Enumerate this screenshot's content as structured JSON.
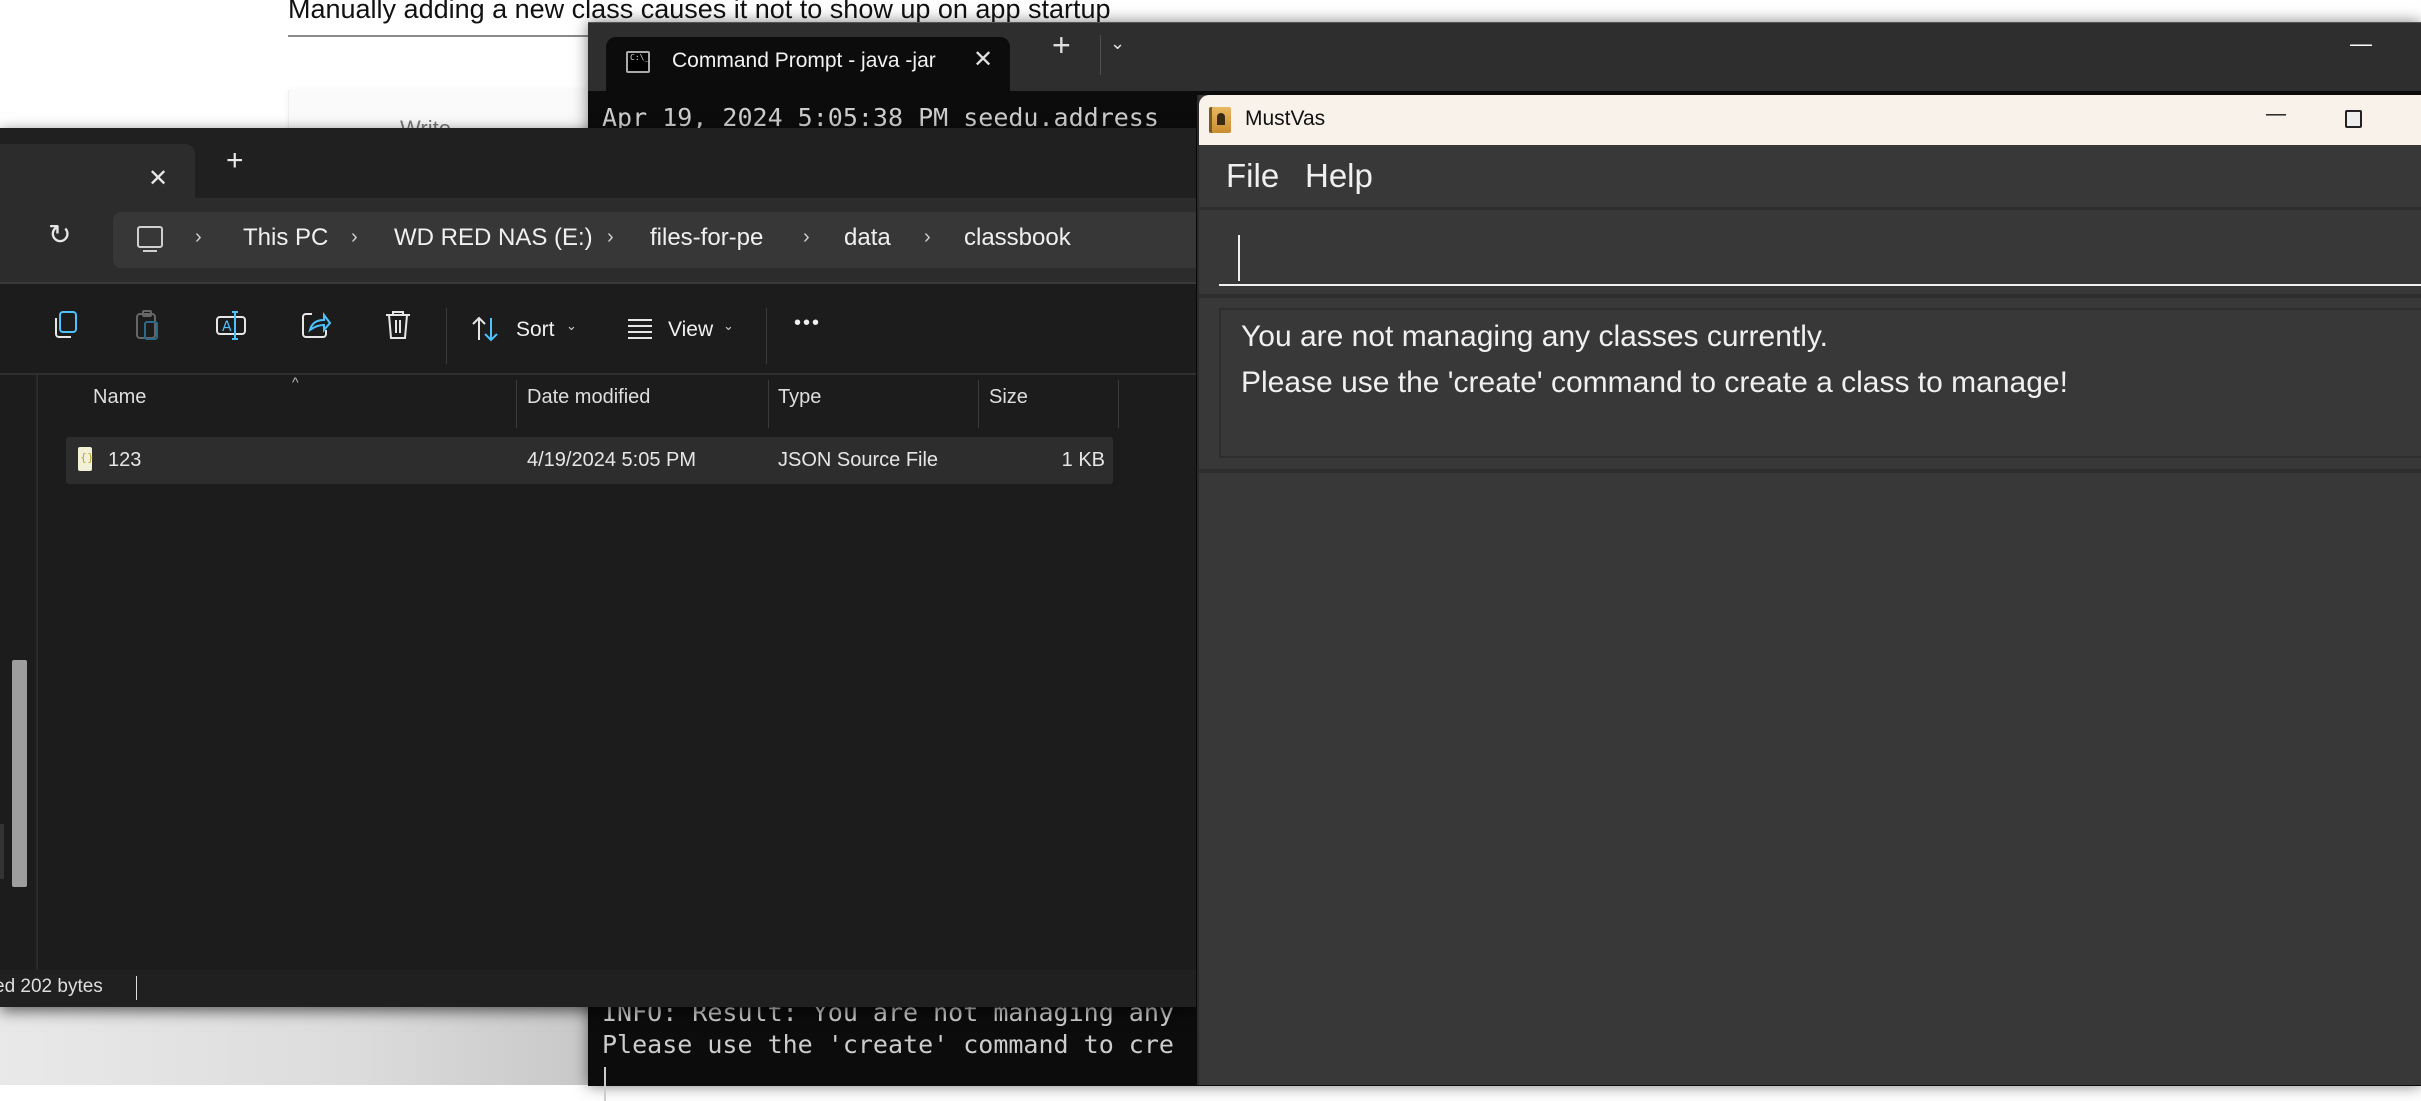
{
  "background_page": {
    "heading": "Manually adding a new class causes it not to show up on app startup",
    "write_tab": "Write"
  },
  "terminal": {
    "tab_title": "Command Prompt - java  -jar",
    "icon": "cmd-icon",
    "lines": [
      "Apr 19, 2024 5:05:38 PM seedu.address",
      "INFO: Result: You are not managing any",
      "Please use the 'create' command to cre"
    ]
  },
  "explorer": {
    "breadcrumb": [
      "This PC",
      "WD RED NAS (E:)",
      "files-for-pe",
      "data",
      "classbook"
    ],
    "toolbar": {
      "icons": [
        "copy-icon",
        "paste-icon",
        "rename-icon",
        "share-icon",
        "delete-icon"
      ],
      "sort_label": "Sort",
      "view_label": "View",
      "more_label": "•••"
    },
    "columns": [
      "Name",
      "Date modified",
      "Type",
      "Size"
    ],
    "files": [
      {
        "name": "123",
        "date_modified": "4/19/2024 5:05 PM",
        "type": "JSON Source File",
        "size": "1 KB"
      }
    ],
    "status": "ed  202 bytes"
  },
  "mustvas": {
    "title": "MustVas",
    "menu": [
      "File",
      "Help"
    ],
    "command_input": {
      "value": "",
      "placeholder": ""
    },
    "result_lines": [
      "You are not managing any classes currently.",
      "Please use the 'create' command to create a class to manage!"
    ]
  }
}
